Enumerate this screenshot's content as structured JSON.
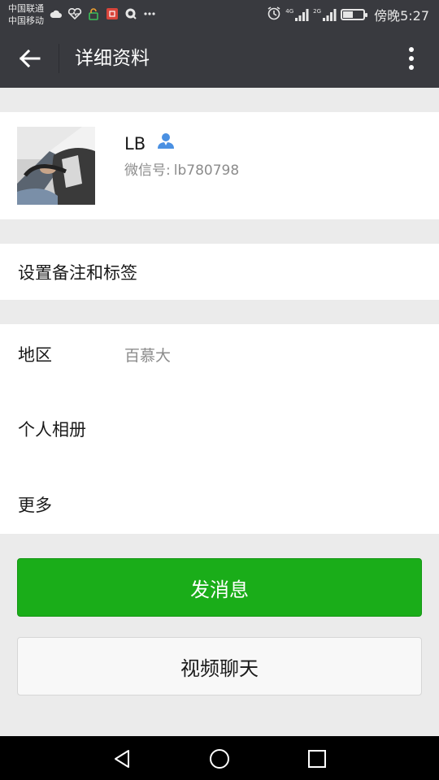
{
  "status_bar": {
    "carrier_1": "中国联通",
    "carrier_2": "中国移动",
    "network_1": "4G",
    "network_2": "2G",
    "time": "傍晚5:27",
    "battery_level": 0.45
  },
  "header": {
    "title": "详细资料"
  },
  "profile": {
    "name": "LB",
    "wechat_id_label": "微信号:",
    "wechat_id": "lb780798"
  },
  "remark": {
    "label": "设置备注和标签"
  },
  "info": {
    "region_label": "地区",
    "region_value": "百慕大",
    "album_label": "个人相册",
    "more_label": "更多"
  },
  "actions": {
    "send_message": "发消息",
    "video_call": "视频聊天"
  },
  "colors": {
    "header_bg": "#393a3f",
    "primary_green": "#1aad19",
    "contact_icon": "#4a90e2"
  }
}
